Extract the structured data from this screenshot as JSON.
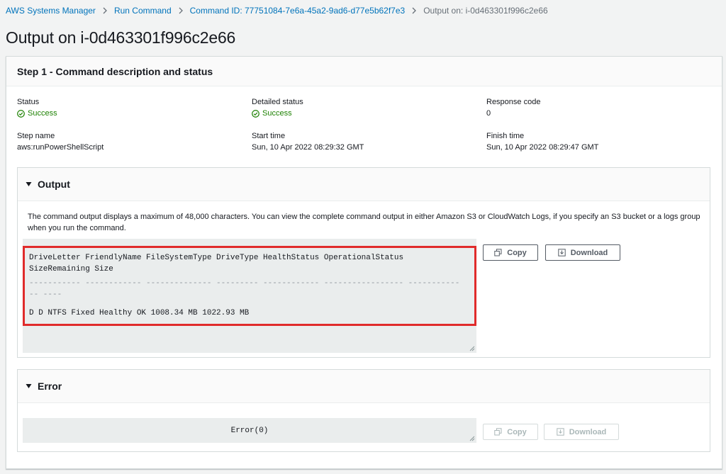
{
  "breadcrumb": {
    "items": [
      {
        "label": "AWS Systems Manager"
      },
      {
        "label": "Run Command"
      },
      {
        "label": "Command ID: 77751084-7e6a-45a2-9ad6-d77e5b62f7e3"
      }
    ],
    "current": "Output on: i-0d463301f996c2e66"
  },
  "page": {
    "title": "Output on i-0d463301f996c2e66"
  },
  "step": {
    "title": "Step 1 - Command description and status",
    "status_label": "Status",
    "status_value": "Success",
    "detailed_status_label": "Detailed status",
    "detailed_status_value": "Success",
    "response_code_label": "Response code",
    "response_code_value": "0",
    "step_name_label": "Step name",
    "step_name_value": "aws:runPowerShellScript",
    "start_time_label": "Start time",
    "start_time_value": "Sun, 10 Apr 2022 08:29:32 GMT",
    "finish_time_label": "Finish time",
    "finish_time_value": "Sun, 10 Apr 2022 08:29:47 GMT"
  },
  "output": {
    "title": "Output",
    "description": "The command output displays a maximum of 48,000 characters. You can view the complete command output in either Amazon S3 or CloudWatch Logs, if you specify an S3 bucket or a logs group when you run the command.",
    "line1": "DriveLetter FriendlyName FileSystemType DriveType HealthStatus OperationalStatus",
    "line2": "SizeRemaining Size",
    "dash1": "----------- ------------ -------------- --------- ------------ ----------------- -----------",
    "dash2": "-- ----",
    "line3": "D D NTFS Fixed Healthy OK 1008.34 MB 1022.93 MB",
    "copy_label": "Copy",
    "download_label": "Download"
  },
  "error": {
    "title": "Error",
    "content": "Error(0)",
    "copy_label": "Copy",
    "download_label": "Download"
  },
  "colors": {
    "link": "#0073bb",
    "success": "#1d8102",
    "highlight_border": "#e02b2b"
  }
}
